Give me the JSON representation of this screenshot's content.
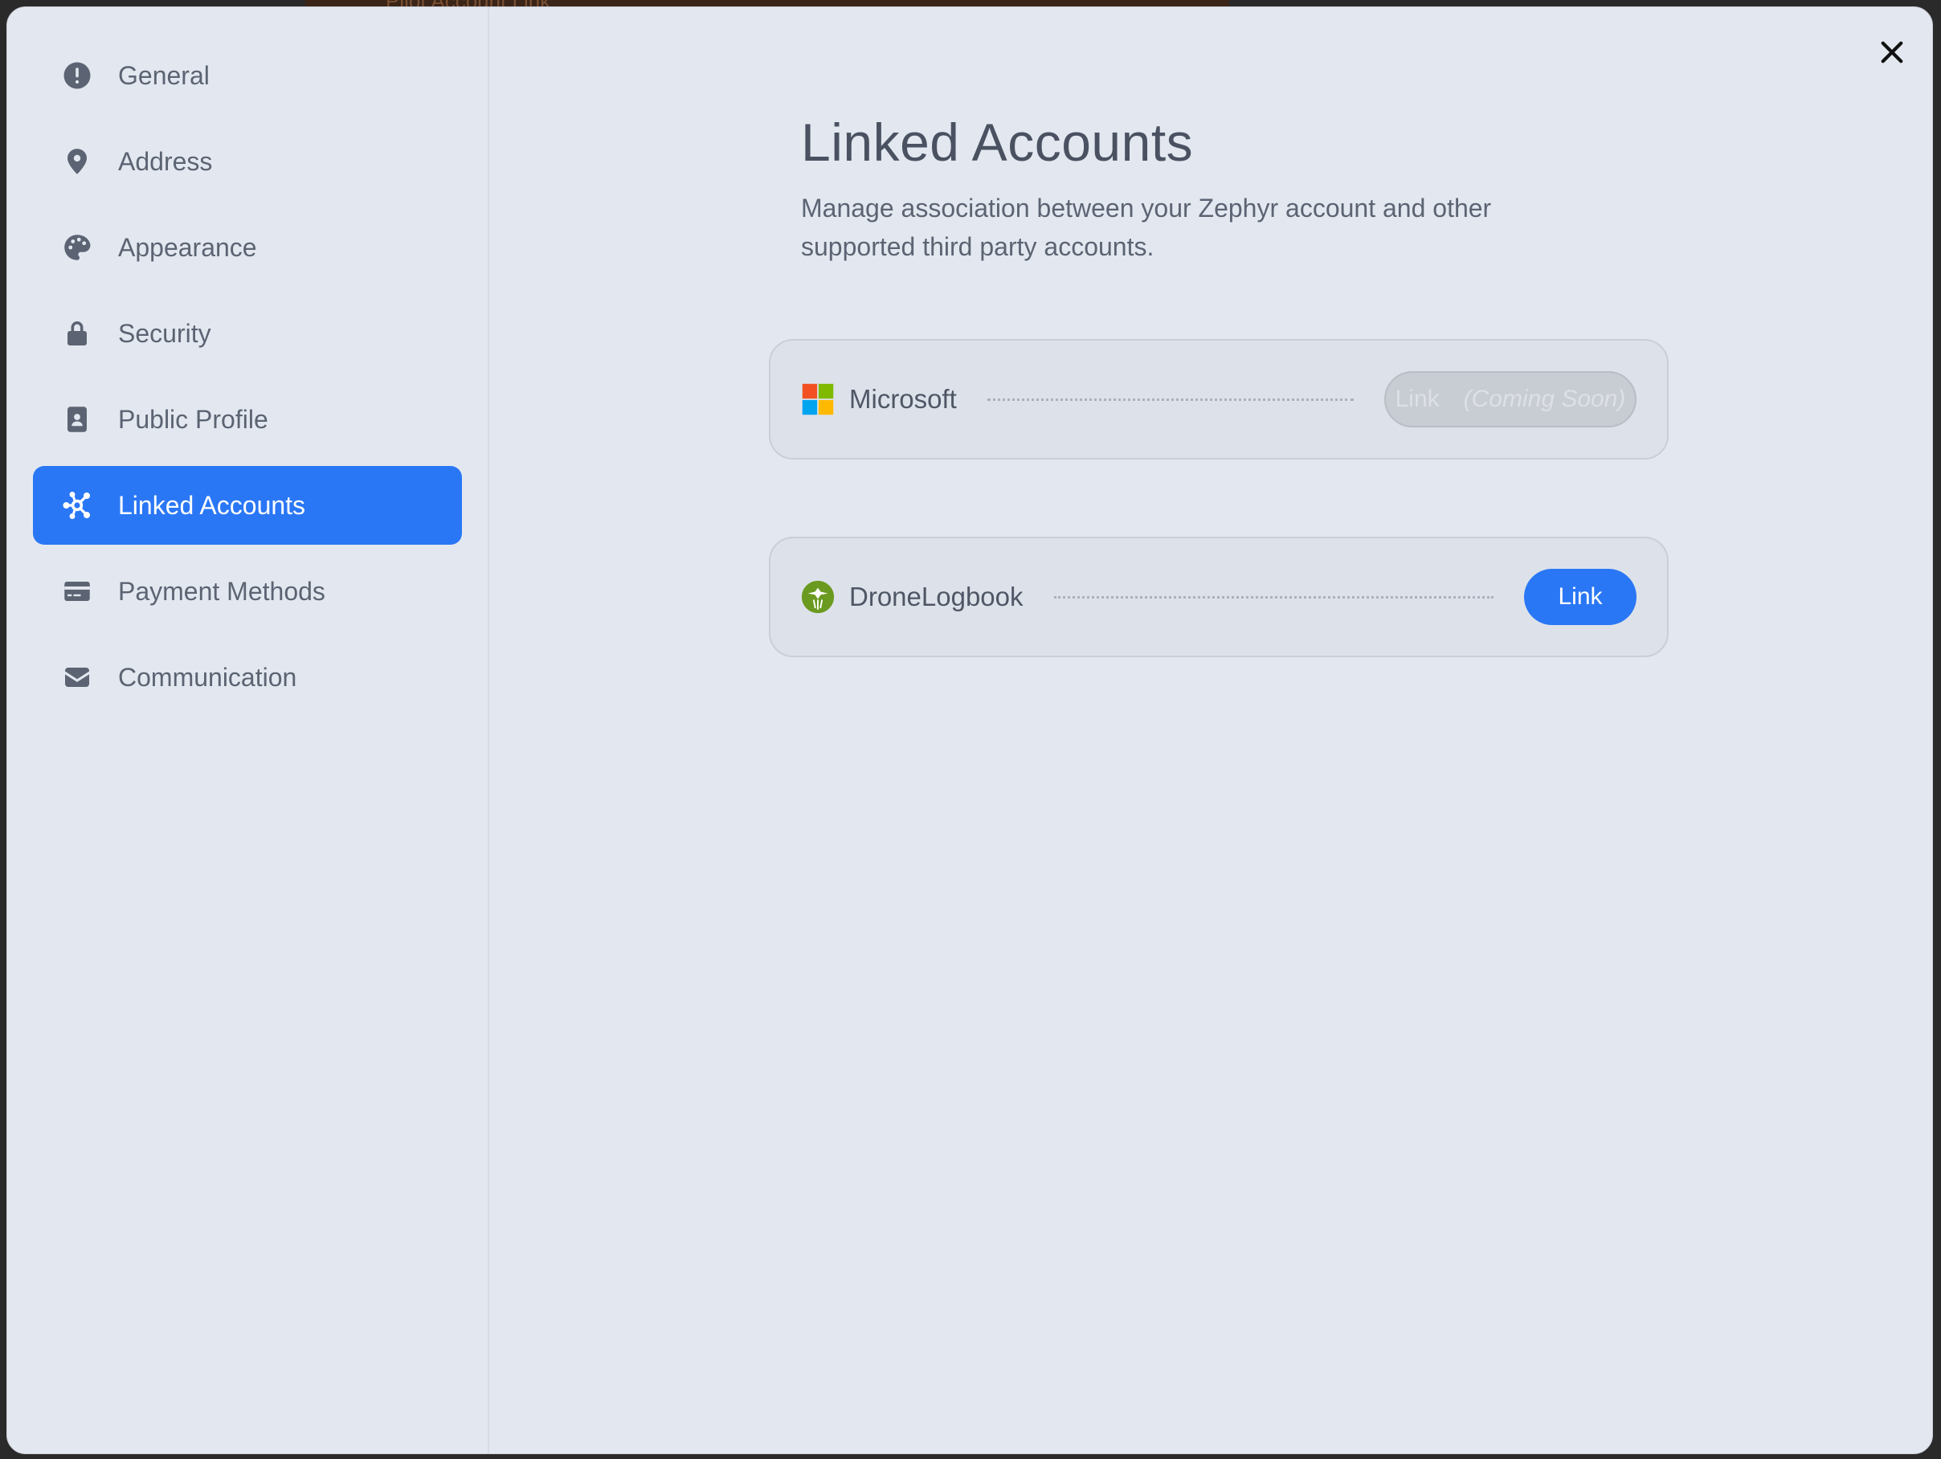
{
  "backdrop": {
    "partial_text": "Pilot Account Link"
  },
  "sidebar": {
    "items": [
      {
        "label": "General",
        "icon": "exclamation-circle-icon",
        "active": false
      },
      {
        "label": "Address",
        "icon": "map-pin-icon",
        "active": false
      },
      {
        "label": "Appearance",
        "icon": "palette-icon",
        "active": false
      },
      {
        "label": "Security",
        "icon": "lock-icon",
        "active": false
      },
      {
        "label": "Public Profile",
        "icon": "id-badge-icon",
        "active": false
      },
      {
        "label": "Linked Accounts",
        "icon": "network-icon",
        "active": true
      },
      {
        "label": "Payment Methods",
        "icon": "credit-card-icon",
        "active": false
      },
      {
        "label": "Communication",
        "icon": "envelope-icon",
        "active": false
      }
    ]
  },
  "header": {
    "close_icon": "close-icon"
  },
  "main": {
    "title": "Linked Accounts",
    "description": "Manage association between your Zephyr account and other supported third party accounts.",
    "accounts": [
      {
        "name": "Microsoft",
        "logo": "microsoft-logo",
        "button_label": "Link",
        "button_note": "(Coming Soon)",
        "enabled": false
      },
      {
        "name": "DroneLogbook",
        "logo": "dronelogbook-logo",
        "button_label": "Link",
        "enabled": true
      }
    ]
  },
  "colors": {
    "accent": "#2a77f5",
    "background": "#e3e8f0",
    "text": "#5c6473",
    "microsoft_red": "#f25022",
    "microsoft_green": "#7fba00",
    "microsoft_blue": "#00a4ef",
    "microsoft_yellow": "#ffb900",
    "dronelogbook_green": "#6a9a1f"
  }
}
